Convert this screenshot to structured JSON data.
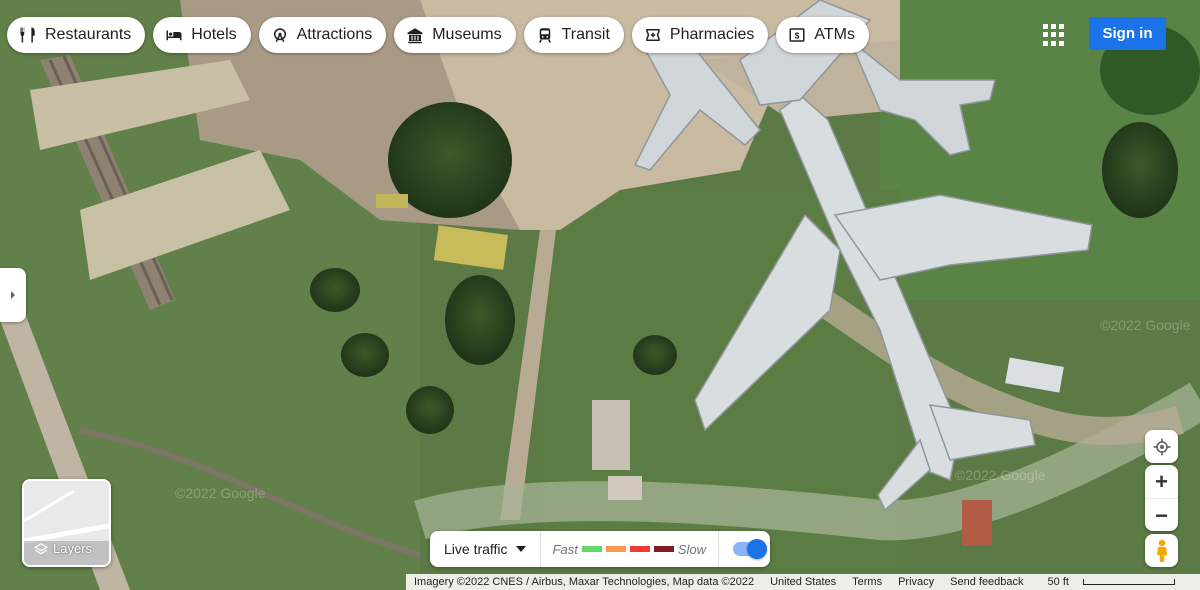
{
  "categories": [
    {
      "label": "Restaurants",
      "icon": "restaurant-icon"
    },
    {
      "label": "Hotels",
      "icon": "bed-icon"
    },
    {
      "label": "Attractions",
      "icon": "attraction-icon"
    },
    {
      "label": "Museums",
      "icon": "museum-icon"
    },
    {
      "label": "Transit",
      "icon": "transit-icon"
    },
    {
      "label": "Pharmacies",
      "icon": "pharmacy-icon"
    },
    {
      "label": "ATMs",
      "icon": "atm-icon"
    }
  ],
  "header": {
    "signin_label": "Sign in",
    "apps_icon": "apps-grid-icon"
  },
  "layers": {
    "label": "Layers"
  },
  "traffic": {
    "label": "Live traffic",
    "fast_label": "Fast",
    "slow_label": "Slow",
    "colors": [
      "#63d668",
      "#ff974d",
      "#f23c32",
      "#811f1f"
    ],
    "enabled": true
  },
  "controls": {
    "zoom_in": "+",
    "zoom_out": "−"
  },
  "footer": {
    "imagery": "Imagery ©2022 CNES / Airbus, Maxar Technologies, Map data ©2022",
    "country": "United States",
    "terms": "Terms",
    "privacy": "Privacy",
    "feedback": "Send feedback",
    "scale": "50 ft"
  },
  "watermarks": [
    "©2022 Google",
    "©2022 Google",
    "©2022 Google"
  ]
}
